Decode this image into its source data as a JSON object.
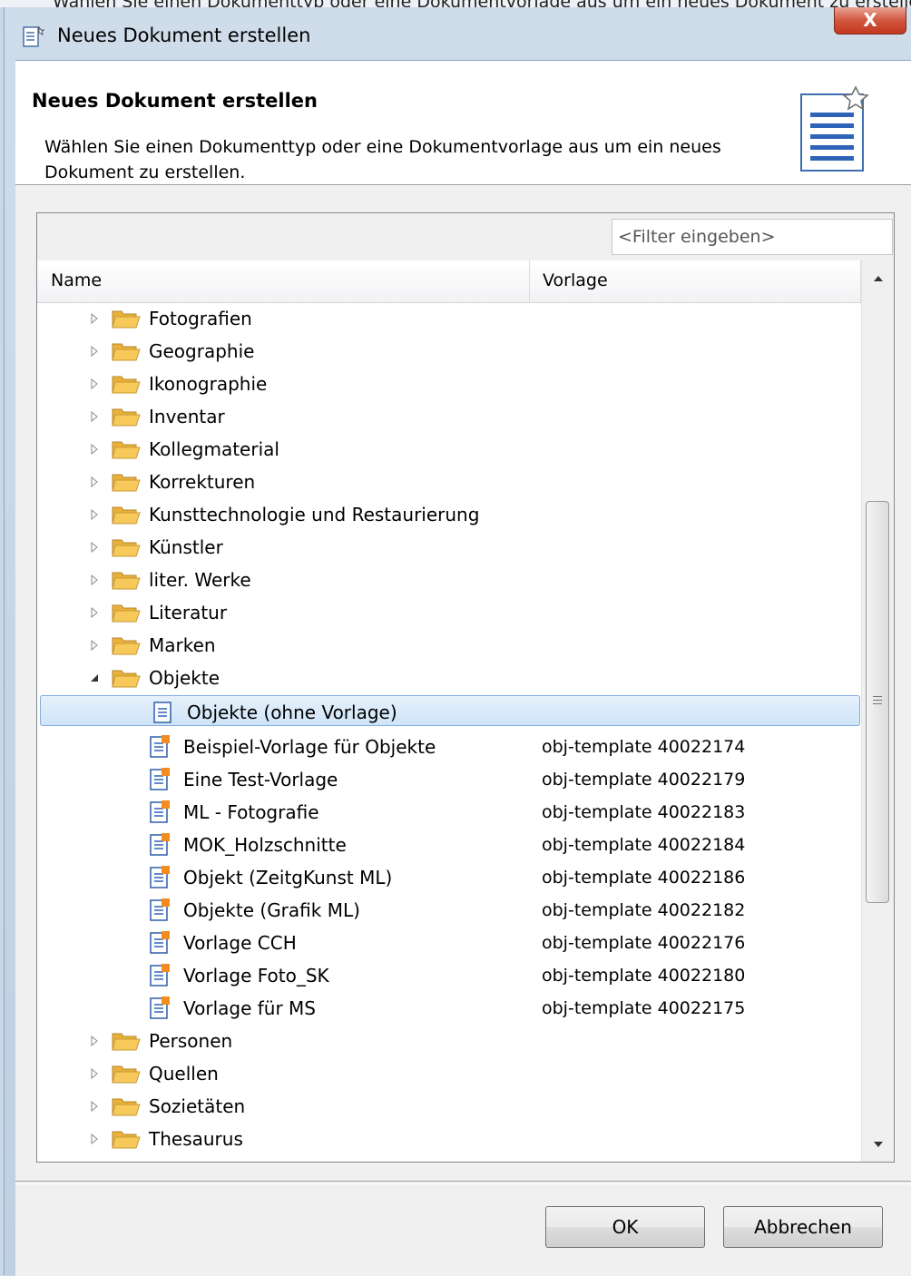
{
  "background_hint_text": "Wählen Sie einen Dokumenttyp oder eine Dokumentvorlage aus um ein neues Dokument zu erstellen.",
  "window": {
    "title": "Neues Dokument erstellen",
    "close_label": "X"
  },
  "header": {
    "title": "Neues Dokument erstellen",
    "description": "Wählen Sie einen Dokumenttyp oder eine Dokumentvorlage aus um ein neues Dokument zu erstellen."
  },
  "filter": {
    "placeholder": "<Filter eingeben>"
  },
  "columns": {
    "name": "Name",
    "vorlage": "Vorlage"
  },
  "tree": {
    "rows": [
      {
        "label": "Fotografien",
        "type": "folder",
        "expanded": false,
        "vorlage": ""
      },
      {
        "label": "Geographie",
        "type": "folder",
        "expanded": false,
        "vorlage": ""
      },
      {
        "label": "Ikonographie",
        "type": "folder",
        "expanded": false,
        "vorlage": ""
      },
      {
        "label": "Inventar",
        "type": "folder",
        "expanded": false,
        "vorlage": ""
      },
      {
        "label": "Kollegmaterial",
        "type": "folder",
        "expanded": false,
        "vorlage": ""
      },
      {
        "label": "Korrekturen",
        "type": "folder",
        "expanded": false,
        "vorlage": ""
      },
      {
        "label": "Kunsttechnologie und Restaurierung",
        "type": "folder",
        "expanded": false,
        "vorlage": ""
      },
      {
        "label": "Künstler",
        "type": "folder",
        "expanded": false,
        "vorlage": ""
      },
      {
        "label": "liter. Werke",
        "type": "folder",
        "expanded": false,
        "vorlage": ""
      },
      {
        "label": "Literatur",
        "type": "folder",
        "expanded": false,
        "vorlage": ""
      },
      {
        "label": "Marken",
        "type": "folder",
        "expanded": false,
        "vorlage": ""
      },
      {
        "label": "Objekte",
        "type": "folder",
        "expanded": true,
        "vorlage": ""
      },
      {
        "label": "Objekte (ohne Vorlage)",
        "type": "doc",
        "selected": true,
        "vorlage": ""
      },
      {
        "label": "Beispiel-Vorlage für Objekte",
        "type": "template",
        "vorlage": "obj-template 40022174"
      },
      {
        "label": "Eine Test-Vorlage",
        "type": "template",
        "vorlage": "obj-template 40022179"
      },
      {
        "label": "ML - Fotografie",
        "type": "template",
        "vorlage": "obj-template 40022183"
      },
      {
        "label": "MOK_Holzschnitte",
        "type": "template",
        "vorlage": "obj-template 40022184"
      },
      {
        "label": "Objekt (ZeitgKunst ML)",
        "type": "template",
        "vorlage": "obj-template 40022186"
      },
      {
        "label": "Objekte (Grafik ML)",
        "type": "template",
        "vorlage": "obj-template 40022182"
      },
      {
        "label": "Vorlage CCH",
        "type": "template",
        "vorlage": "obj-template 40022176"
      },
      {
        "label": "Vorlage Foto_SK",
        "type": "template",
        "vorlage": "obj-template 40022180"
      },
      {
        "label": "Vorlage für MS",
        "type": "template",
        "vorlage": "obj-template 40022175"
      },
      {
        "label": "Personen",
        "type": "folder",
        "expanded": false,
        "vorlage": ""
      },
      {
        "label": "Quellen",
        "type": "folder",
        "expanded": false,
        "vorlage": ""
      },
      {
        "label": "Sozietäten",
        "type": "folder",
        "expanded": false,
        "vorlage": ""
      },
      {
        "label": "Thesaurus",
        "type": "folder",
        "expanded": false,
        "vorlage": ""
      }
    ]
  },
  "buttons": {
    "ok": "OK",
    "cancel": "Abbrechen"
  },
  "colors": {
    "selection": "#cfe4f8",
    "folder": "#f7c85a",
    "template_badge": "#f28c1e",
    "doc_lines": "#2e63b8",
    "close_button": "#c2381f"
  }
}
